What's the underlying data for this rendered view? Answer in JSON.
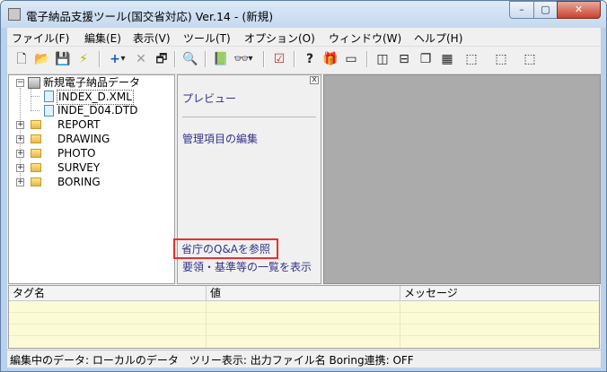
{
  "window": {
    "title": "電子納品支援ツール(国交省対応) Ver.14 - (新規)",
    "controls": {
      "minimize": "–",
      "maximize": "▢",
      "close": "✕"
    }
  },
  "menu": [
    "ファイル(F)",
    "編集(E)",
    "表示(V)",
    "ツール(T)",
    "オプション(O)",
    "ウィンドウ(W)",
    "ヘルプ(H)"
  ],
  "toolbar": [
    {
      "name": "new-icon",
      "glyph": "🗋"
    },
    {
      "name": "open-folder-icon",
      "glyph": "📂"
    },
    {
      "name": "save-icon",
      "glyph": "💾"
    },
    {
      "name": "lightning-icon",
      "glyph": "⚡"
    },
    {
      "name": "add-icon",
      "glyph": "+"
    },
    {
      "name": "dropdown-arrow-icon",
      "glyph": "▾"
    },
    {
      "name": "delete-icon",
      "glyph": "✕"
    },
    {
      "name": "properties-icon",
      "glyph": "🗗"
    },
    {
      "name": "print-preview-icon",
      "glyph": "🔍"
    },
    {
      "name": "book-icon",
      "glyph": "📗"
    },
    {
      "name": "binoculars-icon",
      "glyph": "👓"
    },
    {
      "name": "dropdown-arrow-icon",
      "glyph": "▾"
    },
    {
      "name": "checklist-icon",
      "glyph": "☑"
    },
    {
      "name": "help-icon",
      "glyph": "?"
    },
    {
      "name": "package-icon",
      "glyph": "🎁"
    },
    {
      "name": "card-icon",
      "glyph": "▭"
    },
    {
      "name": "layout-split-vertical-icon",
      "glyph": "◫"
    },
    {
      "name": "layout-split-horizontal-icon",
      "glyph": "⊟"
    },
    {
      "name": "cascade-icon",
      "glyph": "❐"
    },
    {
      "name": "tile-icon",
      "glyph": "▦"
    },
    {
      "name": "window-arrange-1-icon",
      "glyph": "⬚"
    },
    {
      "name": "window-arrange-2-icon",
      "glyph": "⬚"
    },
    {
      "name": "window-arrange-3-icon",
      "glyph": "⬚"
    }
  ],
  "tree": {
    "root": "新規電子納品データ",
    "files": [
      "INDEX_D.XML",
      "INDE_D04.DTD"
    ],
    "folders": [
      "REPORT",
      "DRAWING",
      "PHOTO",
      "SURVEY",
      "BORING"
    ],
    "expand_collapsed": "+",
    "expand_expanded": "−"
  },
  "task_pane": {
    "close": "x",
    "preview": "プレビュー",
    "edit_items": "管理項目の編集",
    "qa_link": "省庁のQ&Aを参照",
    "guidelines_link": "要領・基準等の一覧を表示"
  },
  "message_list": {
    "columns": [
      "タグ名",
      "値",
      "メッセージ"
    ]
  },
  "status": "編集中のデータ: ローカルのデータ　ツリー表示: 出力ファイル名  Boring連携: OFF",
  "colors": {
    "highlight_border": "#e53030",
    "message_background": "#fbfbd6",
    "preview_background": "#ababab"
  }
}
